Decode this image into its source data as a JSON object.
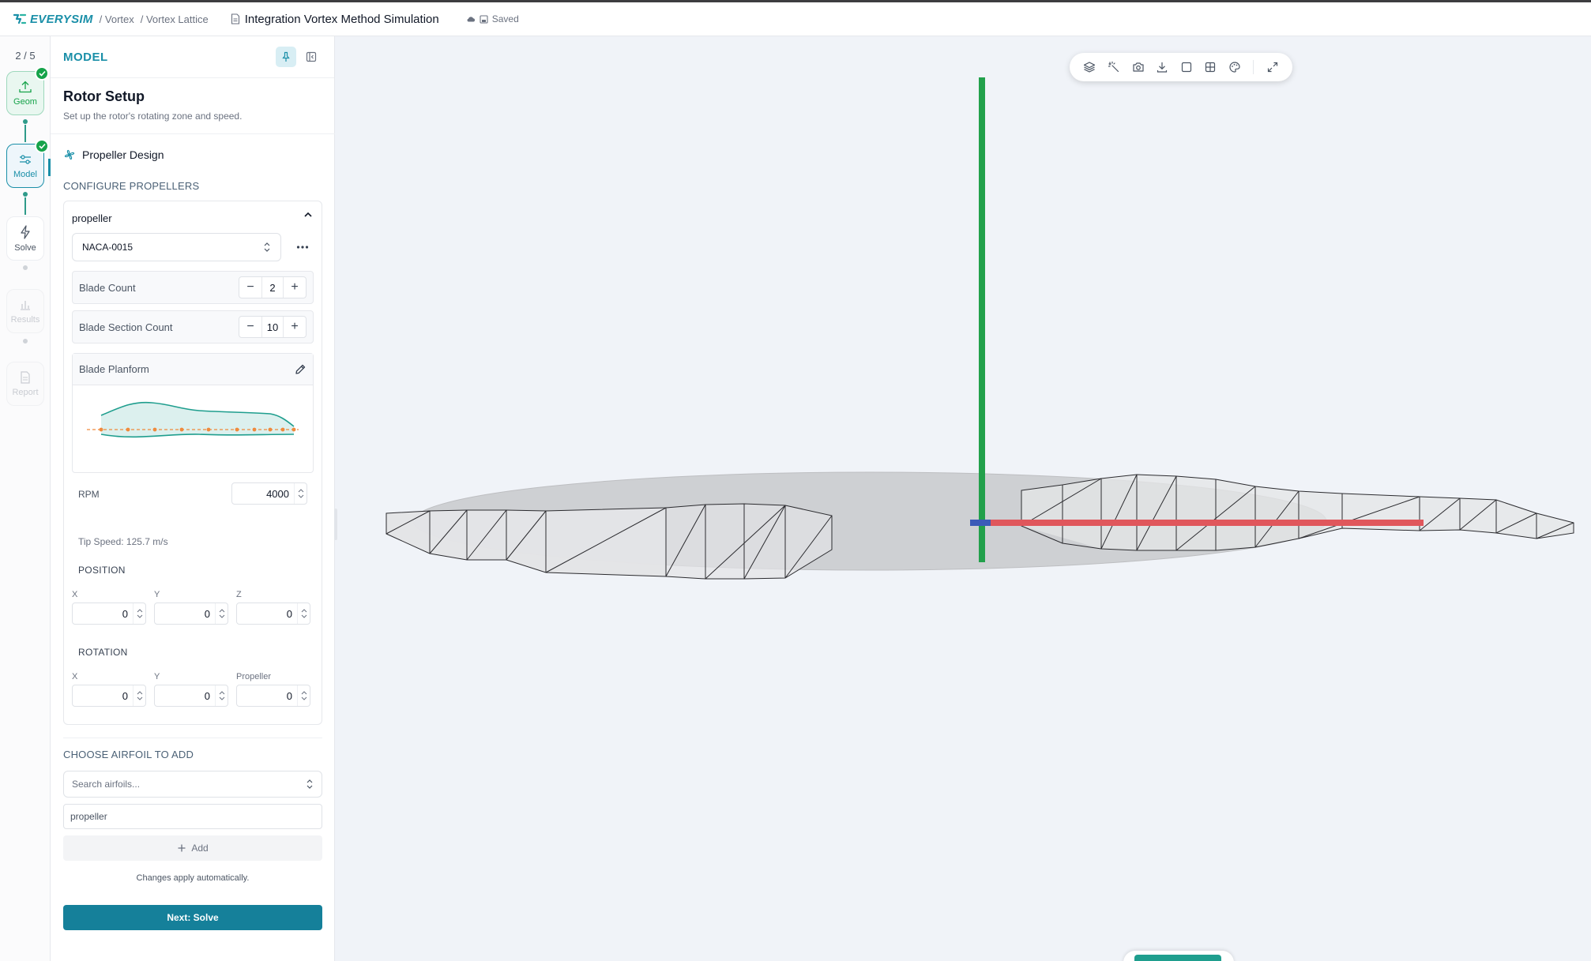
{
  "topbar": {
    "logo_text": "EVERYSIM",
    "crumbs": [
      "/ Vortex",
      "/ Vortex Lattice"
    ],
    "doc_title": "Integration Vortex Method Simulation",
    "saved_label": "Saved"
  },
  "rail": {
    "step_count": "2 / 5",
    "steps": [
      {
        "label": "Geom",
        "state": "done",
        "icon": "upload-icon"
      },
      {
        "label": "Model",
        "state": "active",
        "icon": "sliders-icon"
      },
      {
        "label": "Solve",
        "state": "idle",
        "icon": "bolt-icon"
      },
      {
        "label": "Results",
        "state": "disabled",
        "icon": "bar-chart-icon"
      },
      {
        "label": "Report",
        "state": "disabled",
        "icon": "document-icon"
      }
    ]
  },
  "panel": {
    "header": "MODEL",
    "section_title": "Rotor Setup",
    "section_sub": "Set up the rotor's rotating zone and speed.",
    "design_label": "Propeller Design",
    "configure_label": "CONFIGURE PROPELLERS",
    "propeller": {
      "name": "propeller",
      "airfoil": "NACA-0015",
      "blade_count_label": "Blade Count",
      "blade_count": "2",
      "section_count_label": "Blade Section Count",
      "section_count": "10",
      "planform_label": "Blade Planform",
      "rpm_label": "RPM",
      "rpm": "4000",
      "tip_speed": "Tip Speed: 125.7 m/s",
      "position_label": "POSITION",
      "position": {
        "x_label": "X",
        "y_label": "Y",
        "z_label": "Z",
        "x": "0",
        "y": "0",
        "z": "0"
      },
      "rotation_label": "ROTATION",
      "rotation": {
        "x_label": "X",
        "y_label": "Y",
        "p_label": "Propeller",
        "x": "0",
        "y": "0",
        "p": "0"
      }
    },
    "choose_label": "CHOOSE AIRFOIL TO ADD",
    "search_placeholder": "Search airfoils...",
    "name_value": "propeller",
    "add_label": "Add",
    "apply_note": "Changes apply automatically.",
    "next_label": "Next: Solve"
  },
  "viewport": {
    "toolbar_icons": [
      "layers-icon",
      "magic-wand-icon",
      "camera-icon",
      "download-icon",
      "square-view-icon",
      "grid-icon",
      "palette-icon",
      "expand-icon"
    ]
  },
  "colors": {
    "accent": "#1a8fa8",
    "done": "#16a34a",
    "axis_x": "#e0575c",
    "axis_y": "#22a04b",
    "axis_z": "#3b5bb8"
  }
}
